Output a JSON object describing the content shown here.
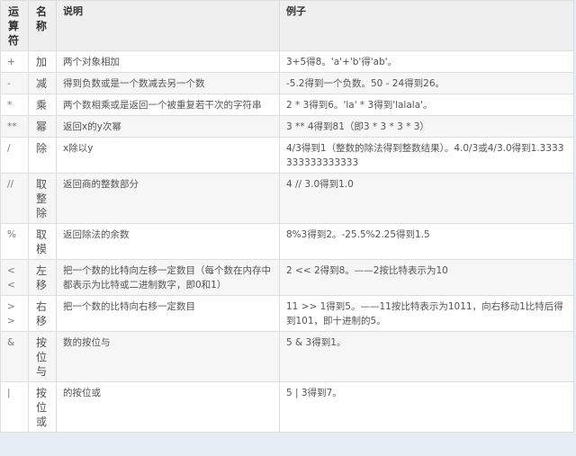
{
  "header": {
    "op": "运算符",
    "name": "名称",
    "desc": "说明",
    "example": "例子"
  },
  "rows": [
    {
      "op": "+",
      "name": "加",
      "desc": "两个对象相加",
      "example": "3+5得8。'a'+'b'得'ab'。"
    },
    {
      "op": "-",
      "name": "减",
      "desc": "得到负数或是一个数减去另一个数",
      "example": "-5.2得到一个负数。50 - 24得到26。"
    },
    {
      "op": "*",
      "name": "乘",
      "desc": "两个数相乘或是返回一个被重复若干次的字符串",
      "example": "2 * 3得到6。'la' * 3得到'lalala'。"
    },
    {
      "op": "**",
      "name": "幂",
      "desc": "返回x的y次幂",
      "example": "3 ** 4得到81（即3 * 3 * 3 * 3）"
    },
    {
      "op": "/",
      "name": "除",
      "desc": "x除以y",
      "example": "4/3得到1（整数的除法得到整数结果）。4.0/3或4/3.0得到1.3333333333333333"
    },
    {
      "op": "//",
      "name": "取整除",
      "desc": "返回商的整数部分",
      "example": "4 // 3.0得到1.0"
    },
    {
      "op": "%",
      "name": "取模",
      "desc": "返回除法的余数",
      "example": "8%3得到2。-25.5%2.25得到1.5"
    },
    {
      "op": "<<",
      "name": "左移",
      "desc": "把一个数的比特向左移一定数目（每个数在内存中都表示为比特或二进制数字，即0和1）",
      "example": " 2 << 2得到8。——2按比特表示为10"
    },
    {
      "op": ">>",
      "name": "右移",
      "desc": "把一个数的比特向右移一定数目",
      "example": "11 >> 1得到5。——11按比特表示为1011，向右移动1比特后得到101，即十进制的5。"
    },
    {
      "op": "&",
      "name": "按位与",
      "desc": "数的按位与",
      "example": "5 & 3得到1。"
    },
    {
      "op": "|",
      "name": "按位或",
      "desc": "的按位或",
      "example": "5 | 3得到7。"
    }
  ]
}
